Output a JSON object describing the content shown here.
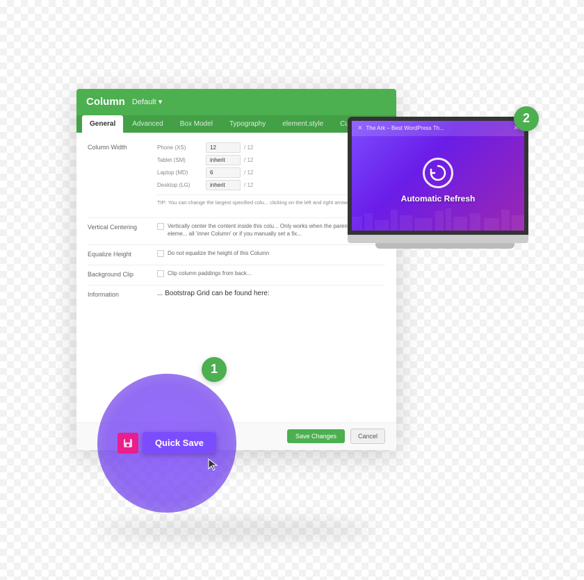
{
  "page": {
    "background": "checkerboard"
  },
  "card": {
    "title": "Column",
    "default_label": "Default ▾",
    "tabs": [
      {
        "id": "general",
        "label": "General",
        "active": true
      },
      {
        "id": "advanced",
        "label": "Advanced",
        "active": false
      },
      {
        "id": "box-model",
        "label": "Box Model",
        "active": false
      },
      {
        "id": "typography",
        "label": "Typography",
        "active": false
      },
      {
        "id": "element-style",
        "label": "element.style",
        "active": false
      },
      {
        "id": "custom-code",
        "label": "Custom Code",
        "active": false
      }
    ],
    "fields": {
      "column_width": {
        "label": "Column Width",
        "rows": [
          {
            "sub_label": "Phone (XS)",
            "value": "12",
            "fraction": "/ 12"
          },
          {
            "sub_label": "Tablet (SM)",
            "value": "inherit",
            "fraction": "/ 12"
          },
          {
            "sub_label": "Laptop (MD)",
            "value": "6",
            "fraction": "/ 12"
          },
          {
            "sub_label": "Desktop (LG)",
            "value": "inherit",
            "fraction": "/ 12"
          }
        ],
        "tip": "TIP: You can change the largest specified colu... clicking on the left and right arrows in the Colu..."
      },
      "vertical_centering": {
        "label": "Vertical Centering",
        "checkbox_text": "Vertically center the content inside this colu... Only works when the parent Row/Section eleme... all 'inner Column' or if you manually set a fix..."
      },
      "equalize_height": {
        "label": "Equalize Height",
        "checkbox_text": "Do not equalize the height of this Column"
      },
      "background_clip": {
        "label": "Background Clip",
        "checkbox_text": "Clip column paddings from back..."
      },
      "information": {
        "label": "Information",
        "text": "... Bootstrap Grid can be found here:"
      }
    },
    "actions": {
      "save_changes_label": "Save Changes",
      "cancel_label": "Cancel"
    }
  },
  "laptop": {
    "browser_tab_text": "The Ark – Best WordPress Th...",
    "close_icon": "✕",
    "screen_label": "Automatic Refresh",
    "refresh_symbol": "↺"
  },
  "badges": {
    "step1": "1",
    "step2": "2"
  },
  "quick_save": {
    "label": "Quick Save",
    "icon_symbol": "⚡",
    "cursor": "⬆"
  }
}
